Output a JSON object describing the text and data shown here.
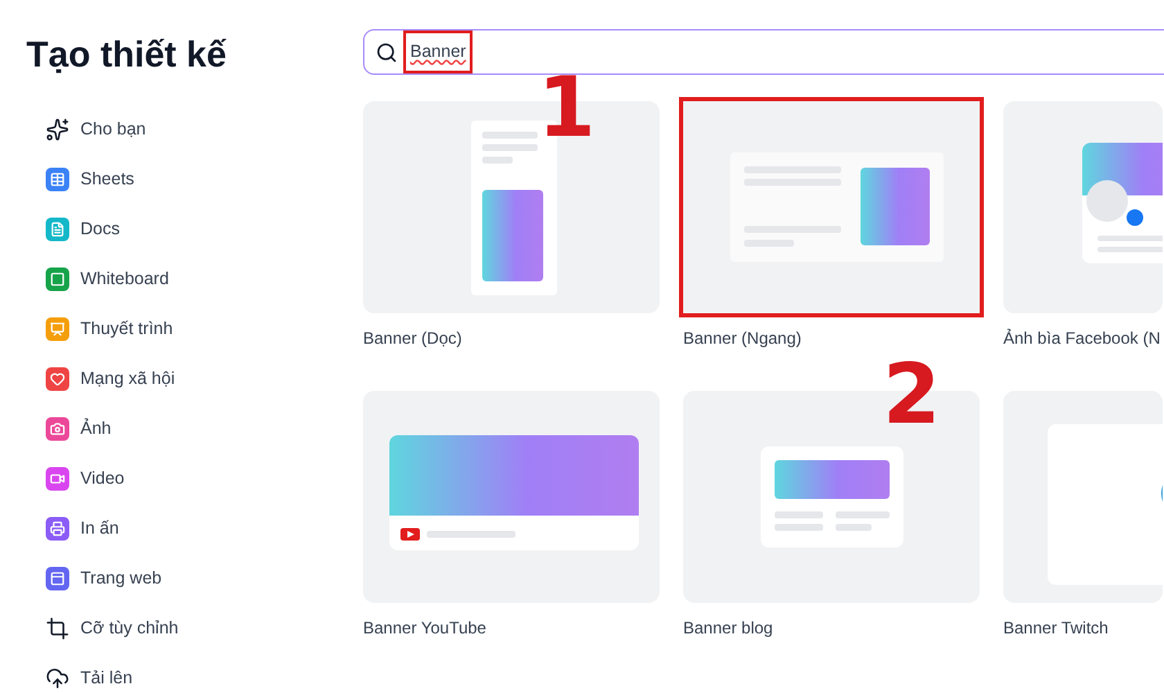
{
  "title": "Tạo thiết kế",
  "categories": [
    {
      "label": "Cho bạn",
      "kind": "sparkles"
    },
    {
      "label": "Sheets",
      "kind": "sheets"
    },
    {
      "label": "Docs",
      "kind": "docs"
    },
    {
      "label": "Whiteboard",
      "kind": "whiteboard"
    },
    {
      "label": "Thuyết trình",
      "kind": "presentation"
    },
    {
      "label": "Mạng xã hội",
      "kind": "social"
    },
    {
      "label": "Ảnh",
      "kind": "photo"
    },
    {
      "label": "Video",
      "kind": "video"
    },
    {
      "label": "In ấn",
      "kind": "print"
    },
    {
      "label": "Trang web",
      "kind": "website"
    },
    {
      "label": "Cỡ tùy chỉnh",
      "kind": "custom"
    },
    {
      "label": "Tải lên",
      "kind": "upload"
    }
  ],
  "search": {
    "value": "Banner",
    "highlighted": true
  },
  "templates": [
    {
      "label": "Banner (Dọc)",
      "kind": "vertical",
      "highlighted": false
    },
    {
      "label": "Banner (Ngang)",
      "kind": "horizontal",
      "highlighted": true
    },
    {
      "label": "Ảnh bìa Facebook (N",
      "kind": "facebook",
      "highlighted": false
    },
    {
      "label": "Banner YouTube",
      "kind": "youtube",
      "highlighted": false
    },
    {
      "label": "Banner blog",
      "kind": "blog",
      "highlighted": false
    },
    {
      "label": "Banner Twitch",
      "kind": "twitch",
      "highlighted": false
    }
  ],
  "annotations": [
    {
      "label": "1"
    },
    {
      "label": "2"
    }
  ]
}
